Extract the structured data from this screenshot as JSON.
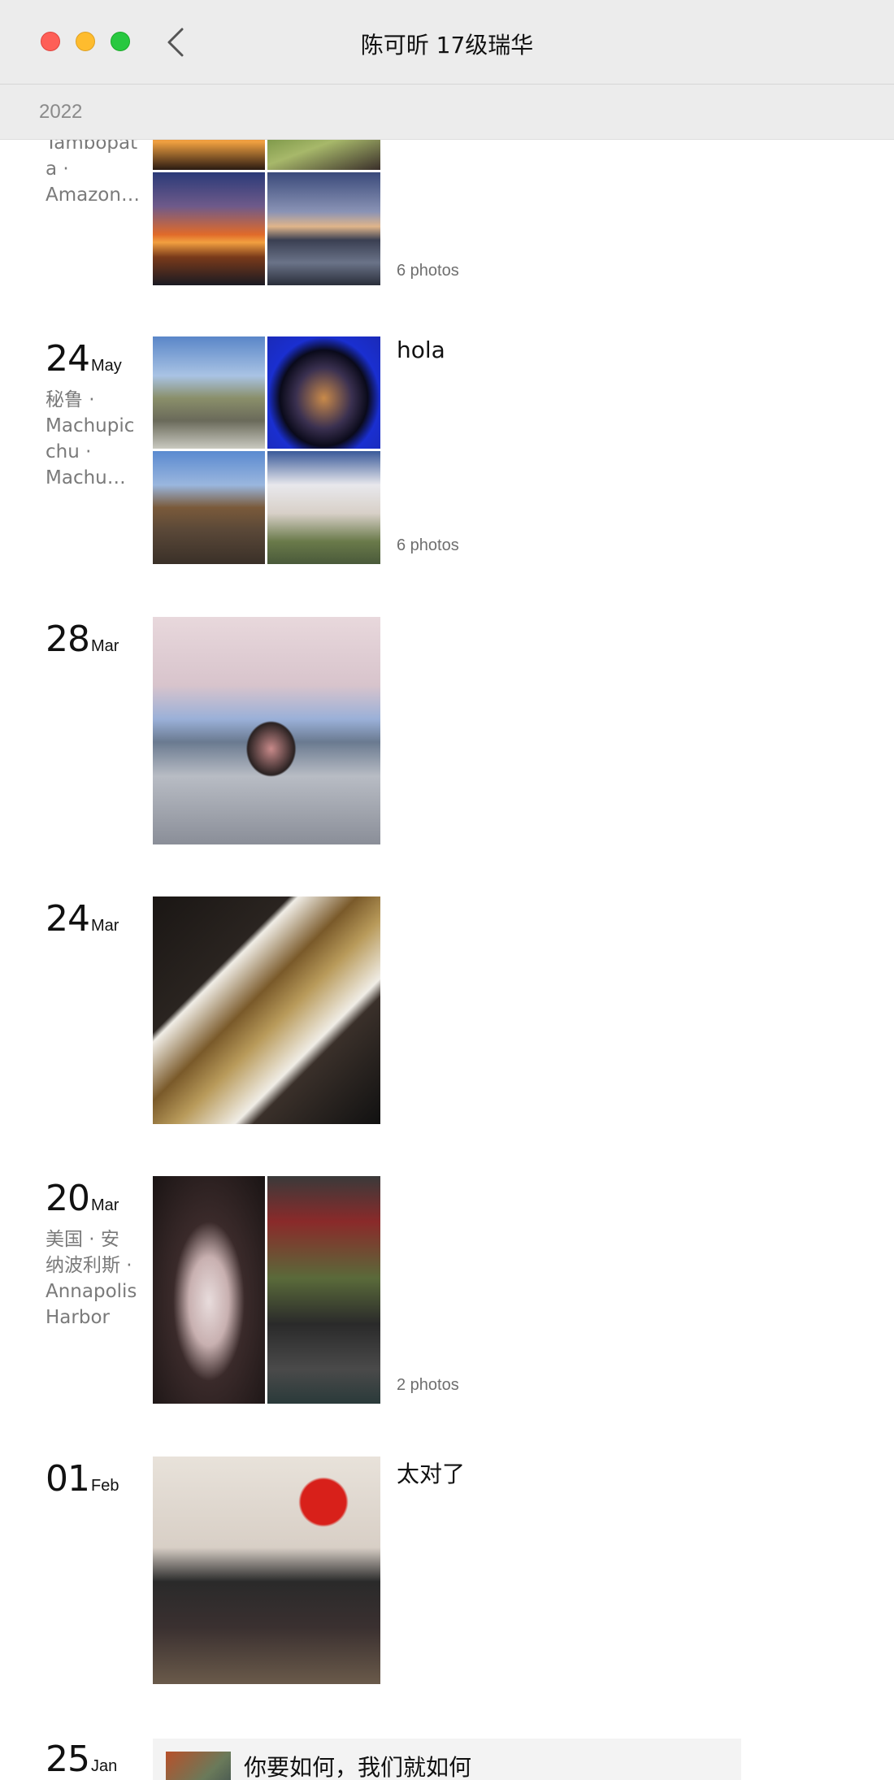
{
  "window": {
    "title": "陈可昕 17级瑞华",
    "back_icon": "chevron-left-icon"
  },
  "year_header": "2022",
  "entries": [
    {
      "location_lines": [
        "Tambopat",
        "a ·",
        "Amazon…"
      ],
      "photo_count": "6 photos"
    },
    {
      "day": "24",
      "month": "May",
      "location_lines": [
        "秘鲁 ·",
        "Machupic",
        "chu ·",
        "Machu…"
      ],
      "caption": "hola",
      "photo_count": "6 photos"
    },
    {
      "day": "28",
      "month": "Mar"
    },
    {
      "day": "24",
      "month": "Mar"
    },
    {
      "day": "20",
      "month": "Mar",
      "location_lines": [
        "美国 · 安",
        "纳波利斯 ·",
        "Annapolis",
        "Harbor"
      ],
      "photo_count": "2 photos"
    },
    {
      "day": "01",
      "month": "Feb",
      "caption": "太对了"
    },
    {
      "day": "25",
      "month": "Jan",
      "article_title": "你要如何，我们就如何"
    }
  ],
  "colors": {
    "titlebar": "#ececec",
    "close": "#fe5f57",
    "minimize": "#febc2e",
    "maximize": "#28c840"
  }
}
